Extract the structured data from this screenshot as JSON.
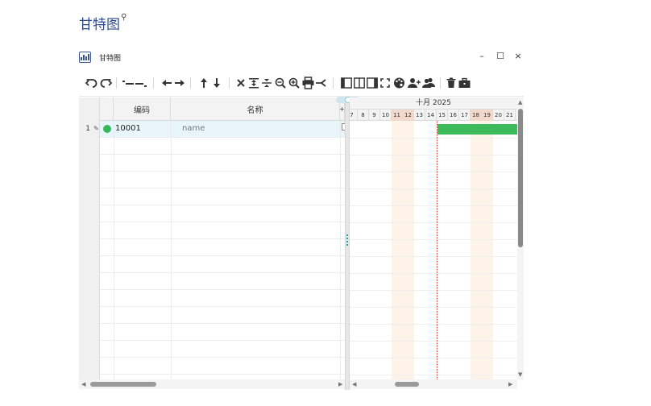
{
  "page": {
    "title": "甘特图",
    "search_icon": "search-icon"
  },
  "window": {
    "title": "甘特图",
    "minimize": "–",
    "maximize": "☐",
    "close": "×"
  },
  "toolbar": {
    "icons": [
      "undo-icon",
      "redo-icon",
      "indent-icon",
      "outdent-icon",
      "move-left-icon",
      "move-right-icon",
      "move-up-icon",
      "move-down-icon",
      "delete-icon",
      "expand-icon",
      "collapse-icon",
      "zoom-out-icon",
      "zoom-in-icon",
      "print-icon",
      "share-icon",
      "left-panel-icon",
      "both-panels-icon",
      "right-panel-icon",
      "fullscreen-icon",
      "palette-icon",
      "add-user-icon",
      "users-icon",
      "trash-icon",
      "toolbox-icon"
    ]
  },
  "grid": {
    "columns": [
      {
        "label": "编码"
      },
      {
        "label": "名称"
      },
      {
        "label": "+"
      }
    ],
    "rows": [
      {
        "num": "1",
        "code": "10001",
        "name": "name",
        "status_color": "#35b85a"
      }
    ]
  },
  "gantt": {
    "month": "十月 2025",
    "days": [
      "7",
      "8",
      "9",
      "10",
      "11",
      "12",
      "13",
      "14",
      "15",
      "16",
      "17",
      "18",
      "19",
      "20",
      "21"
    ],
    "weekend_days": [
      "11",
      "12",
      "18",
      "19"
    ],
    "today": "14",
    "task_bar": {
      "start_day": "15",
      "color": "#3dbb5c"
    }
  }
}
